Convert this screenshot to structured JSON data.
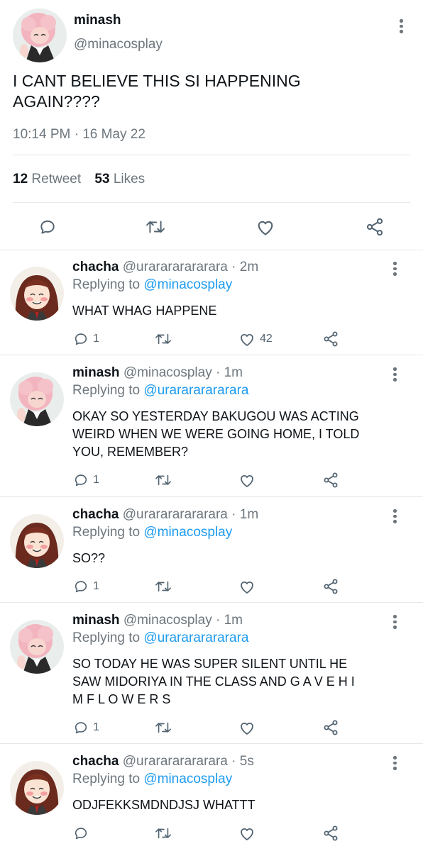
{
  "main_tweet": {
    "display_name": "minash",
    "handle": "@minacosplay",
    "text_line1": "I CANT BELIEVE THIS SI HAPPENING",
    "text_line2": "AGAIN????",
    "timestamp": "10:14 PM · 16 May 22",
    "retweet_count": "12",
    "retweet_label": "Retweet",
    "likes_count": "53",
    "likes_label": "Likes"
  },
  "replying_to_label": "Replying to",
  "replies": [
    {
      "name": "chacha",
      "handle": "@urarararararara",
      "time": "· 2m",
      "replying_to": "@minacosplay",
      "lines": [
        "WHAT WHAG HAPPENE"
      ],
      "reply_count": "1",
      "like_count": "42"
    },
    {
      "name": "minash",
      "handle": "@minacosplay",
      "time": "· 1m",
      "replying_to": "@urarararararara",
      "lines": [
        "OKAY SO YESTERDAY BAKUGOU WAS ACTING",
        "WEIRD WHEN WE WERE GOING HOME, I TOLD",
        "YOU, REMEMBER?"
      ],
      "reply_count": "1",
      "like_count": ""
    },
    {
      "name": "chacha",
      "handle": "@urarararararara",
      "time": "· 1m",
      "replying_to": "@minacosplay",
      "lines": [
        "SO??"
      ],
      "reply_count": "1",
      "like_count": ""
    },
    {
      "name": "minash",
      "handle": "@minacosplay",
      "time": "· 1m",
      "replying_to": "@urarararararara",
      "lines": [
        "SO TODAY HE WAS SUPER SILENT UNTIL HE",
        "SAW MIDORIYA IN THE CLASS AND G A V E H I",
        "M F L O W E R S"
      ],
      "reply_count": "1",
      "like_count": ""
    },
    {
      "name": "chacha",
      "handle": "@urarararararara",
      "time": "· 5s",
      "replying_to": "@minacosplay",
      "lines": [
        "ODJFEKKSMDNDJSJ WHATTT"
      ],
      "reply_count": "",
      "like_count": ""
    }
  ],
  "icons": [
    "more-icon",
    "reply-icon",
    "retweet-icon",
    "like-icon",
    "share-icon"
  ],
  "colors": {
    "link": "#1d9bf0",
    "meta": "#6e767d",
    "text": "#0f1419",
    "divider": "#e6e8ea",
    "icon": "#536471"
  }
}
